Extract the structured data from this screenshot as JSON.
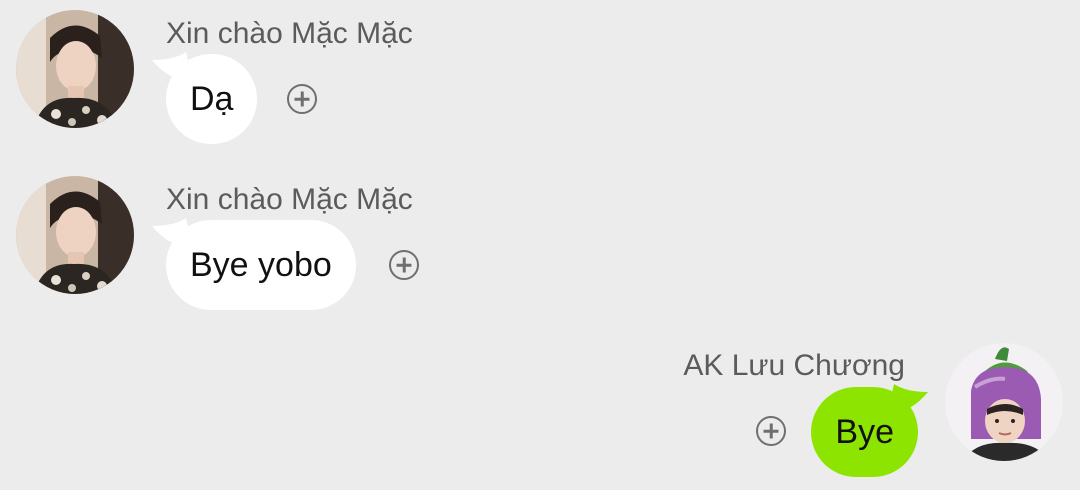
{
  "messages": [
    {
      "direction": "incoming",
      "sender": "Xin chào Mặc Mặc",
      "text": "Dạ",
      "avatar_icon": "profile-photo-boy-avatar"
    },
    {
      "direction": "incoming",
      "sender": "Xin chào Mặc Mặc",
      "text": "Bye yobo",
      "avatar_icon": "profile-photo-boy-avatar"
    },
    {
      "direction": "outgoing",
      "sender": "AK Lưu Chương",
      "text": "Bye",
      "avatar_icon": "eggplant-hat-avatar"
    }
  ],
  "react_icon": "add-circle-icon",
  "colors": {
    "background": "#ececec",
    "incoming_bubble": "#ffffff",
    "outgoing_bubble": "#8de400",
    "sender_text": "#5b5b5b",
    "message_text": "#111111"
  }
}
